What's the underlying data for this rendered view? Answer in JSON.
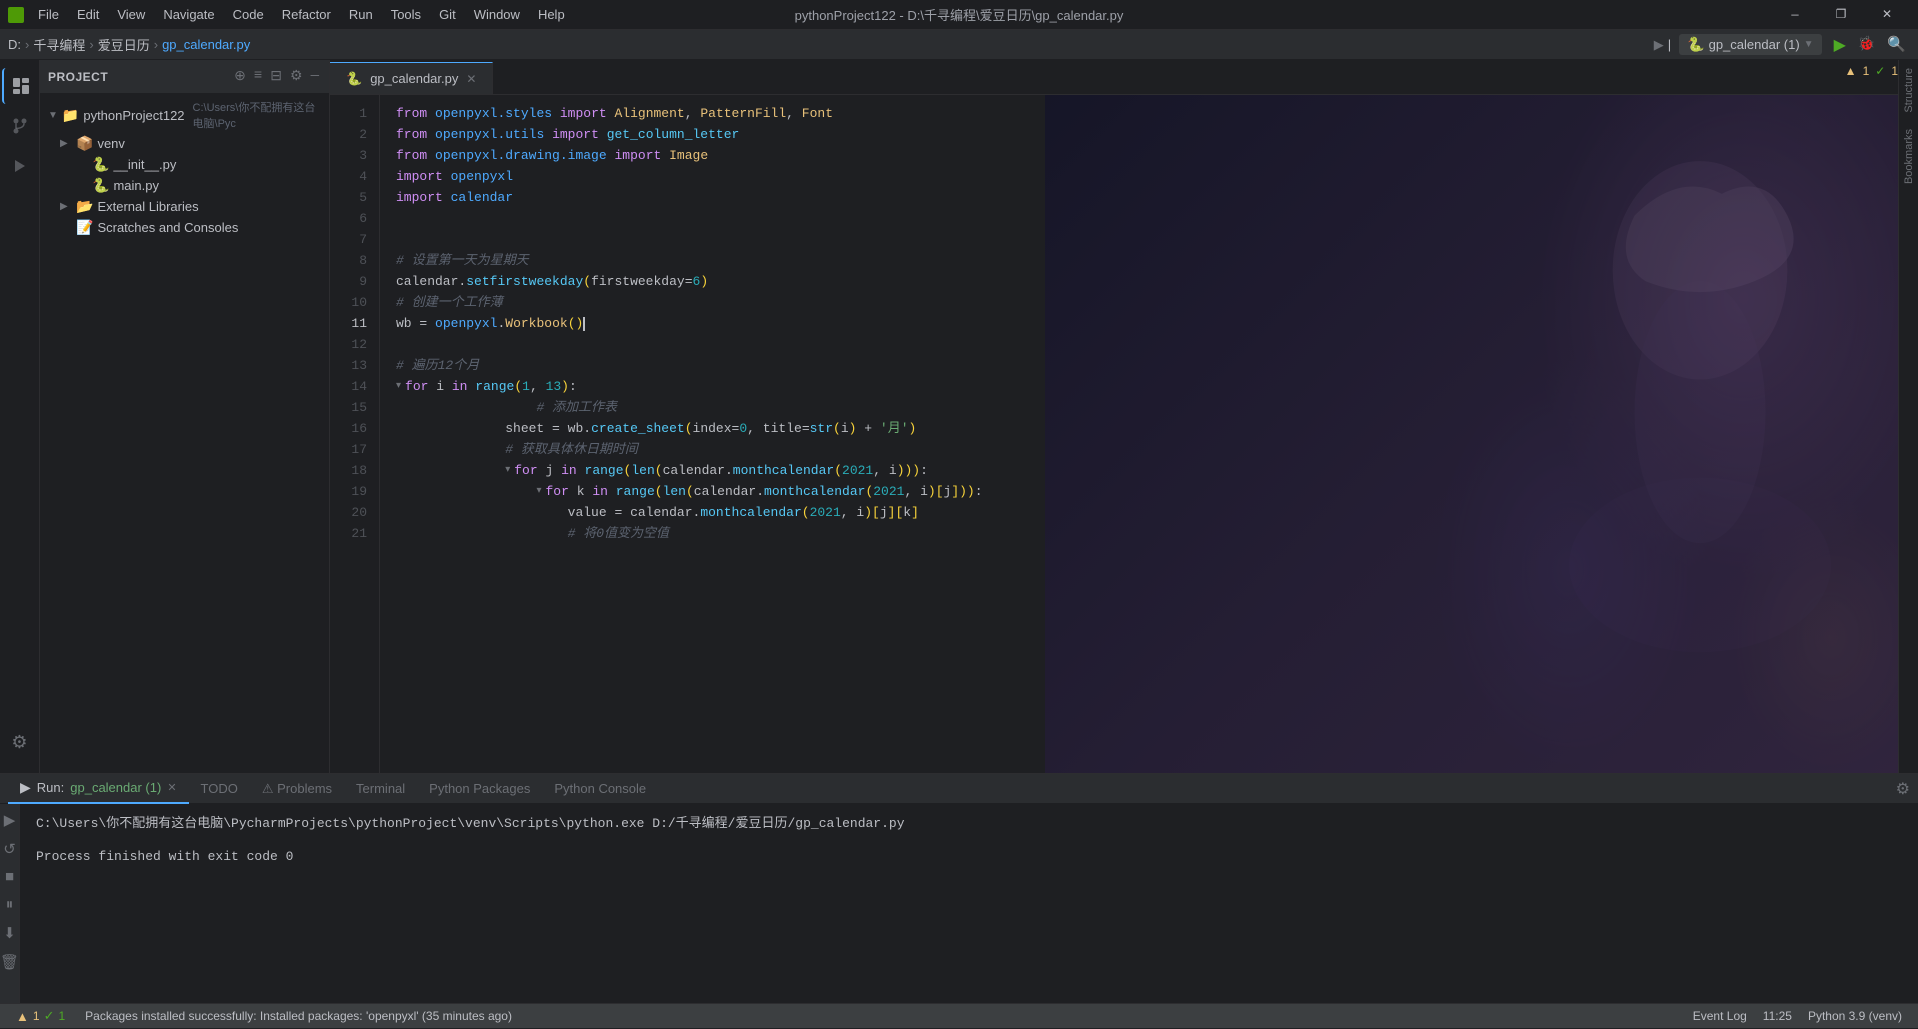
{
  "titlebar": {
    "icon_label": "Py",
    "menus": [
      "File",
      "Edit",
      "View",
      "Navigate",
      "Code",
      "Refactor",
      "Run",
      "Tools",
      "Git",
      "Window",
      "Help"
    ],
    "title": "pythonProject122 - D:\\千寻编程\\爱豆日历\\gp_calendar.py",
    "controls": [
      "—",
      "❐",
      "✕"
    ]
  },
  "toolbar": {
    "breadcrumbs": [
      "D:",
      "千寻编程",
      "爱豆日历",
      "gp_calendar.py"
    ],
    "run_config": "gp_calendar (1)",
    "run_btn_label": "▶",
    "debug_btn_label": "🐞",
    "search_btn": "🔍"
  },
  "side_panel": {
    "title": "Project",
    "root_item": "pythonProject122",
    "root_path": "C:\\Users\\你不配拥有这台电脑\\Pyc",
    "items": [
      {
        "label": "venv",
        "type": "folder",
        "indent": 1,
        "expanded": false
      },
      {
        "label": "__init__.py",
        "type": "py",
        "indent": 2
      },
      {
        "label": "main.py",
        "type": "py",
        "indent": 2
      },
      {
        "label": "External Libraries",
        "type": "folder",
        "indent": 1,
        "expanded": false
      },
      {
        "label": "Scratches and Consoles",
        "type": "item",
        "indent": 1
      }
    ]
  },
  "editor": {
    "tab_name": "gp_calendar.py",
    "warnings": "▲1  ✓1",
    "code_lines": [
      {
        "num": 1,
        "content": "from openpyxl.styles import Alignment, PatternFill, Font"
      },
      {
        "num": 2,
        "content": "from openpyxl.utils import get_column_letter"
      },
      {
        "num": 3,
        "content": "from openpyxl.drawing.image import Image"
      },
      {
        "num": 4,
        "content": "import openpyxl"
      },
      {
        "num": 5,
        "content": "import calendar"
      },
      {
        "num": 6,
        "content": ""
      },
      {
        "num": 7,
        "content": ""
      },
      {
        "num": 8,
        "content": "# 设置第一天为星期天"
      },
      {
        "num": 9,
        "content": "calendar.setfirstweekday(firstweekday=6)"
      },
      {
        "num": 10,
        "content": "# 创建一个工作薄"
      },
      {
        "num": 11,
        "content": "wb = openpyxl.Workbook()"
      },
      {
        "num": 12,
        "content": ""
      },
      {
        "num": 13,
        "content": "# 遍历12个月"
      },
      {
        "num": 14,
        "content": "for i in range(1, 13):"
      },
      {
        "num": 15,
        "content": "    # 添加工作表"
      },
      {
        "num": 16,
        "content": "    sheet = wb.create_sheet(index=0, title=str(i) + '月')"
      },
      {
        "num": 17,
        "content": "    # 获取具体休日期时间"
      },
      {
        "num": 18,
        "content": "    for j in range(len(calendar.monthcalendar(2021, i))):"
      },
      {
        "num": 19,
        "content": "        for k in range(len(calendar.monthcalendar(2021, i)[j])):"
      },
      {
        "num": 20,
        "content": "            value = calendar.monthcalendar(2021, i)[j][k]"
      },
      {
        "num": 21,
        "content": "            # 将0值变为空值"
      }
    ]
  },
  "run_panel": {
    "tab_label": "Run:",
    "tab_name": "gp_calendar (1)",
    "command": "C:\\Users\\你不配拥有这台电脑\\PycharmProjects\\pythonProject\\venv\\Scripts\\python.exe D:/千寻编程/爱豆日历/gp_calendar.py",
    "result": "Process finished with exit code 0"
  },
  "status_bar": {
    "warning_label": "▲1",
    "check_label": "✓1",
    "message": "Packages installed successfully: Installed packages: 'openpyxl' (35 minutes ago)",
    "time": "11:25",
    "python_version": "Python 3.9 (venv)",
    "event_log": "Event Log"
  },
  "bottom_tabs": [
    {
      "label": "▶  Run",
      "active": true
    },
    {
      "label": "TODO"
    },
    {
      "label": "⚠ Problems"
    },
    {
      "label": "Terminal"
    },
    {
      "label": "Python Packages"
    },
    {
      "label": "Python Console"
    }
  ]
}
